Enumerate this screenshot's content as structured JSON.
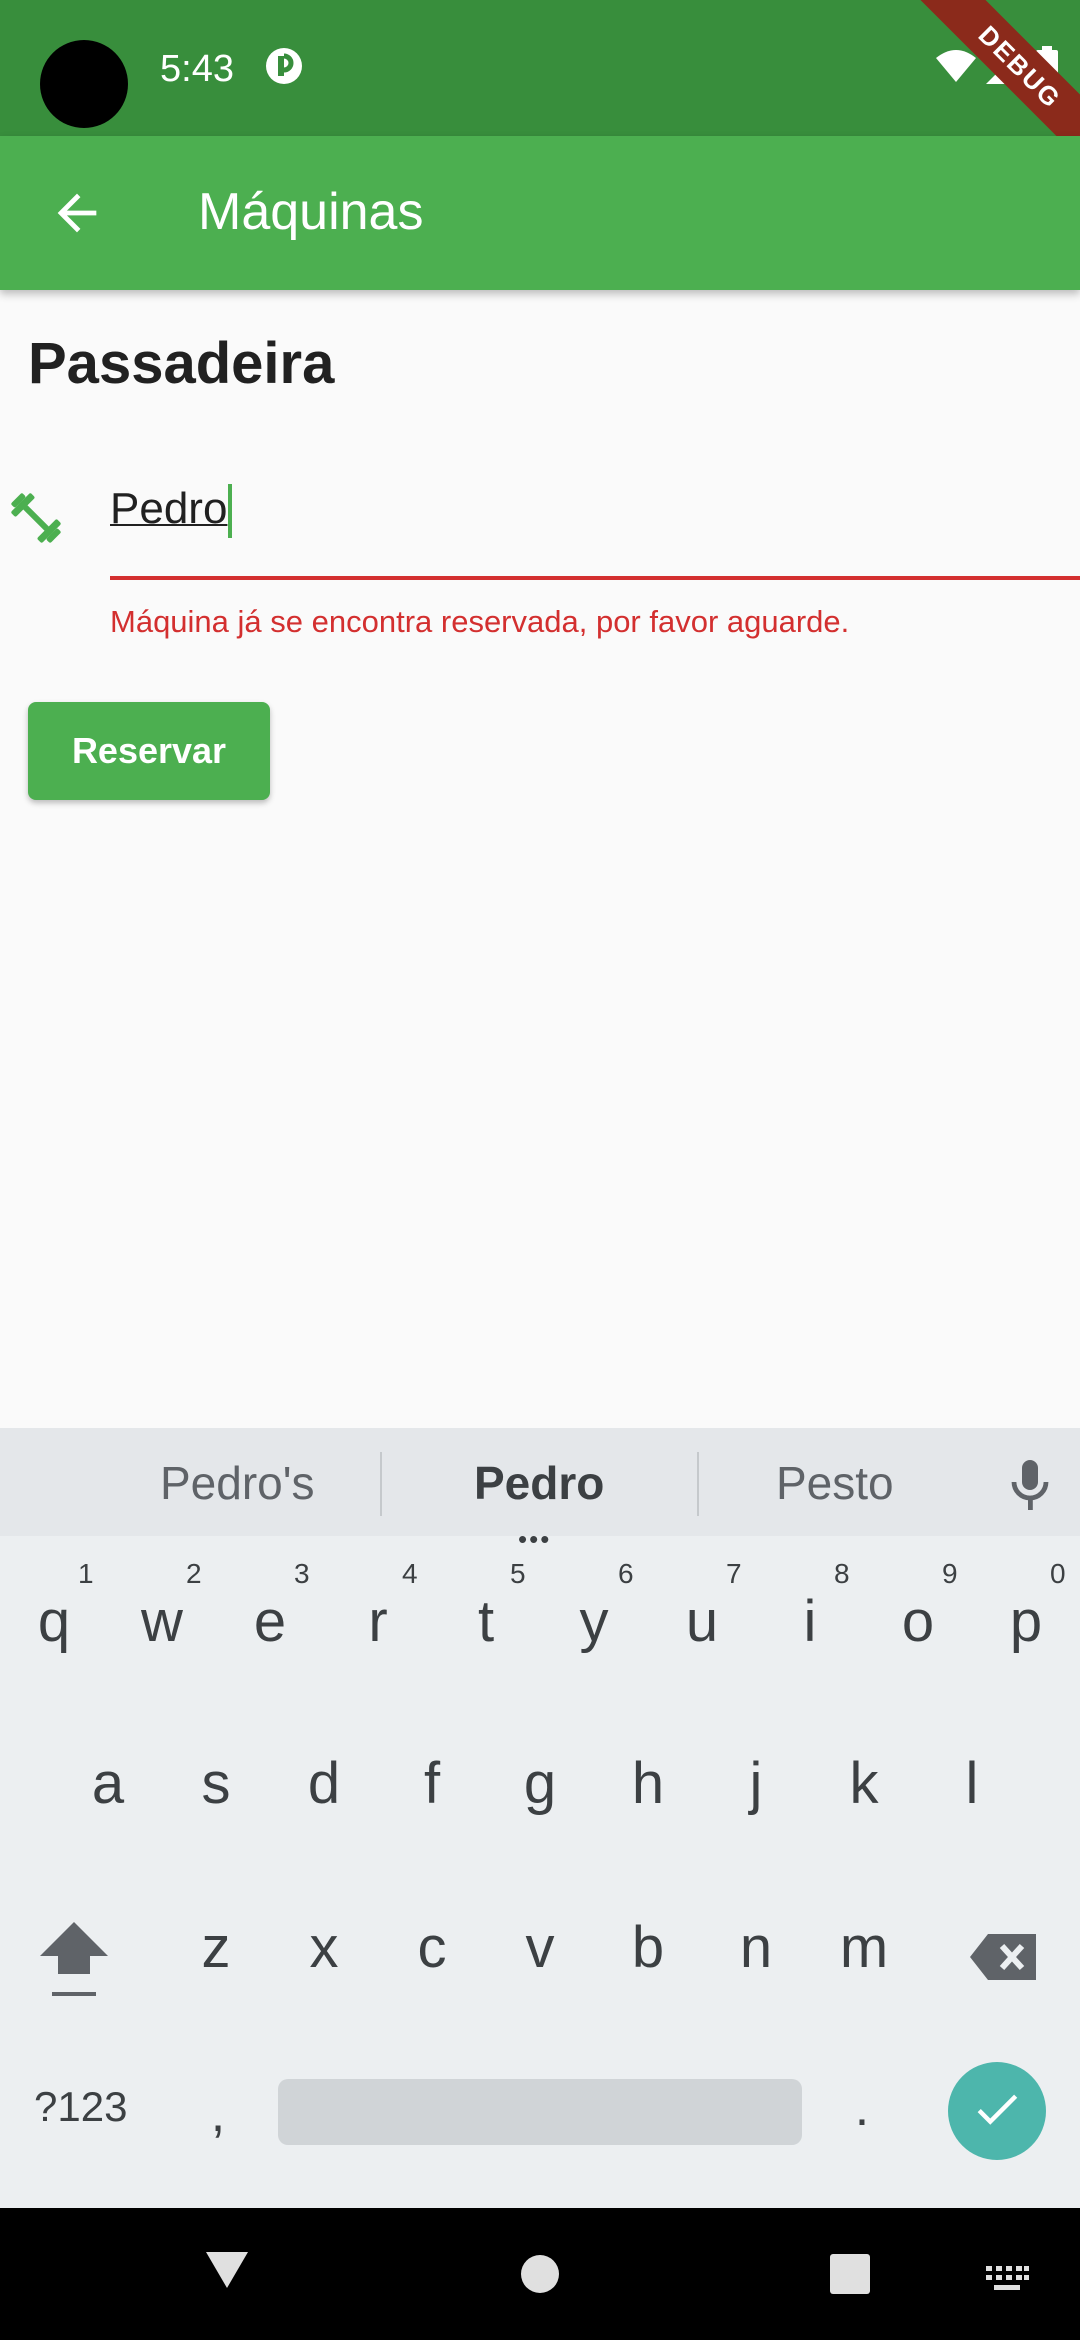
{
  "status": {
    "time": "5:43",
    "debug_label": "DEBUG"
  },
  "appbar": {
    "title": "Máquinas"
  },
  "machine": {
    "name": "Passadeira"
  },
  "field": {
    "value": "Pedro",
    "error": "Máquina já se encontra reservada, por favor aguarde."
  },
  "button": {
    "label": "Reservar"
  },
  "colors": {
    "primary": "#4CAF50",
    "primary_dark": "#388E3C",
    "error": "#D32F2F",
    "accent": "#4DB6AC"
  },
  "keyboard": {
    "suggestions": [
      "Pedro's",
      "Pedro",
      "Pesto"
    ],
    "row1": [
      "q",
      "w",
      "e",
      "r",
      "t",
      "y",
      "u",
      "i",
      "o",
      "p"
    ],
    "row1_nums": [
      "1",
      "2",
      "3",
      "4",
      "5",
      "6",
      "7",
      "8",
      "9",
      "0"
    ],
    "row2": [
      "a",
      "s",
      "d",
      "f",
      "g",
      "h",
      "j",
      "k",
      "l"
    ],
    "row3": [
      "z",
      "x",
      "c",
      "v",
      "b",
      "n",
      "m"
    ],
    "symbols_label": "?123",
    "comma": ",",
    "period": "."
  }
}
